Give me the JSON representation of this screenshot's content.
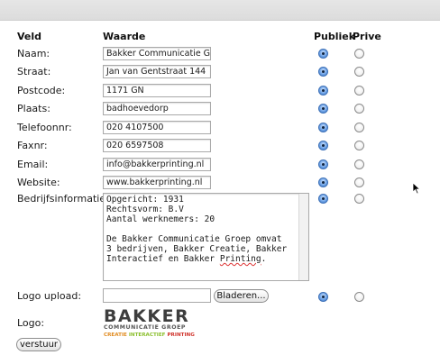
{
  "headers": {
    "veld": "Veld",
    "waarde": "Waarde",
    "publiek": "Publiek",
    "prive": "Prive"
  },
  "rows": [
    {
      "label": "Naam:",
      "value": "Bakker Communicatie Groep",
      "publiek": true
    },
    {
      "label": "Straat:",
      "value": "Jan van Gentstraat 144",
      "publiek": true
    },
    {
      "label": "Postcode:",
      "value": "1171 GN",
      "publiek": true
    },
    {
      "label": "Plaats:",
      "value": "badhoevedorp",
      "publiek": true
    },
    {
      "label": "Telefoonnr:",
      "value": "020 4107500",
      "publiek": true
    },
    {
      "label": "Faxnr:",
      "value": "020 6597508",
      "publiek": true
    },
    {
      "label": "Email:",
      "value": "info@bakkerprinting.nl",
      "publiek": true
    },
    {
      "label": "Website:",
      "value": "www.bakkerprinting.nl",
      "publiek": true
    }
  ],
  "bedrijfsinfo": {
    "label": "Bedrijfsinformatie:",
    "lines": [
      "Opgericht: 1931",
      "Rechtsvorm: B.V",
      "Aantal werknemers: 20",
      "",
      "De Bakker Communicatie Groep omvat",
      "3 bedrijven, Bakker Creatie, Bakker",
      "Interactief en Bakker "
    ],
    "misspelled": "Printing",
    "end": ".",
    "publiek": true
  },
  "logo_upload": {
    "label": "Logo upload:",
    "browse_label": "Bladeren...",
    "publiek": true
  },
  "logo": {
    "label": "Logo:",
    "brand": "BAKKER",
    "tagline": "COMMUNICATIE GROEP",
    "sub": [
      "CREATIE",
      "INTERACTIEF",
      "PRINTING"
    ],
    "colors": {
      "brand": "#3d3d3d",
      "creatie": "#e08a1e",
      "interactief": "#8bbf2e",
      "printing": "#d0342c"
    }
  },
  "submit_label": "verstuur"
}
